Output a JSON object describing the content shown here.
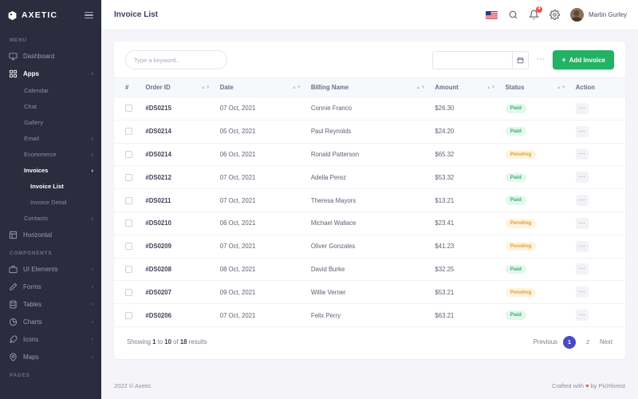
{
  "brand": {
    "name": "AXETIC",
    "logo_icon": "hexagon-shield-icon",
    "menu_icon": "hamburger-icon"
  },
  "sidebar": {
    "section_menu": "MENU",
    "section_components": "COMPONENTS",
    "section_pages": "PAGES",
    "items": [
      {
        "label": "Dashboard",
        "icon": "monitor-icon",
        "arrow": "",
        "active": false
      },
      {
        "label": "Apps",
        "icon": "grid-icon",
        "arrow": "›",
        "active": true
      }
    ],
    "apps_children": [
      {
        "label": "Calendar",
        "arrow": ""
      },
      {
        "label": "Chat",
        "arrow": ""
      },
      {
        "label": "Gallery",
        "arrow": ""
      },
      {
        "label": "Email",
        "arrow": "›"
      },
      {
        "label": "Ecommerce",
        "arrow": "›"
      },
      {
        "label": "Invoices",
        "arrow": "›"
      }
    ],
    "invoice_children": [
      {
        "label": "Invoice List",
        "active": true
      },
      {
        "label": "Invoice Detail",
        "active": false
      }
    ],
    "contacts": {
      "label": "Contacts",
      "arrow": "›"
    },
    "horizontal": {
      "label": "Horizontal",
      "icon": "layout-icon"
    },
    "components": [
      {
        "label": "UI Elements",
        "icon": "briefcase-icon",
        "arrow": "›"
      },
      {
        "label": "Forms",
        "icon": "pen-icon",
        "arrow": "›"
      },
      {
        "label": "Tables",
        "icon": "database-icon",
        "arrow": "›"
      },
      {
        "label": "Charts",
        "icon": "pie-chart-icon",
        "arrow": "›"
      },
      {
        "label": "Icons",
        "icon": "feather-icon",
        "arrow": "›"
      },
      {
        "label": "Maps",
        "icon": "map-pin-icon",
        "arrow": "›"
      }
    ]
  },
  "topbar": {
    "page_title": "Invoice List",
    "flag_icon": "us-flag-icon",
    "search_icon": "search-icon",
    "bell_icon": "bell-icon",
    "notification_count": "4",
    "gear_icon": "gear-icon",
    "user_name": "Martin Gurley",
    "avatar": "user-avatar"
  },
  "toolbar": {
    "search_placeholder": "Type a keyword...",
    "search_value": "",
    "date_value": "",
    "date_placeholder": "",
    "calendar_icon": "calendar-icon",
    "more_label": "⋯",
    "add_label": "Add Invoice",
    "add_plus": "+",
    "accent_green": "#22b264"
  },
  "table": {
    "columns": [
      {
        "label": "#",
        "sortable": false
      },
      {
        "label": "Order ID",
        "sortable": true
      },
      {
        "label": "Date",
        "sortable": true
      },
      {
        "label": "Billing Name",
        "sortable": true
      },
      {
        "label": "Amount",
        "sortable": true
      },
      {
        "label": "Status",
        "sortable": true
      },
      {
        "label": "Action",
        "sortable": false
      }
    ],
    "rows": [
      {
        "order_id": "#DS0215",
        "date": "07 Oct, 2021",
        "name": "Connie Franco",
        "amount": "$26.30",
        "status": "Paid",
        "status_type": "paid"
      },
      {
        "order_id": "#DS0214",
        "date": "05 Oct, 2021",
        "name": "Paul Reynolds",
        "amount": "$24.20",
        "status": "Paid",
        "status_type": "paid"
      },
      {
        "order_id": "#DS0214",
        "date": "06 Oct, 2021",
        "name": "Ronald Patterson",
        "amount": "$65.32",
        "status": "Pending",
        "status_type": "pending"
      },
      {
        "order_id": "#DS0212",
        "date": "07 Oct, 2021",
        "name": "Adella Perez",
        "amount": "$53.32",
        "status": "Paid",
        "status_type": "paid"
      },
      {
        "order_id": "#DS0211",
        "date": "07 Oct, 2021",
        "name": "Theresa Mayors",
        "amount": "$13.21",
        "status": "Paid",
        "status_type": "paid"
      },
      {
        "order_id": "#DS0210",
        "date": "06 Oct, 2021",
        "name": "Michael Wallace",
        "amount": "$23.41",
        "status": "Pending",
        "status_type": "pending"
      },
      {
        "order_id": "#DS0209",
        "date": "07 Oct, 2021",
        "name": "Oliver Gonzales",
        "amount": "$41.23",
        "status": "Pending",
        "status_type": "pending"
      },
      {
        "order_id": "#DS0208",
        "date": "08 Oct, 2021",
        "name": "David Burke",
        "amount": "$32.25",
        "status": "Paid",
        "status_type": "paid"
      },
      {
        "order_id": "#DS0207",
        "date": "09 Oct, 2021",
        "name": "Willie Verner",
        "amount": "$53.21",
        "status": "Pending",
        "status_type": "pending"
      },
      {
        "order_id": "#DS0206",
        "date": "07 Oct, 2021",
        "name": "Felix Perry",
        "amount": "$63.21",
        "status": "Paid",
        "status_type": "paid"
      }
    ],
    "action_label": "⋯"
  },
  "pagination": {
    "showing_prefix": "Showing",
    "from": "1",
    "mid": "to",
    "to": "10",
    "of": "of",
    "total": "18",
    "suffix": "results",
    "previous": "Previous",
    "next": "Next",
    "pages": [
      {
        "label": "1",
        "active": true
      },
      {
        "label": "2",
        "active": false
      }
    ],
    "active_color": "#4a4ac4"
  },
  "footer": {
    "copyright": "2022 © Axetic.",
    "crafted_prefix": "Crafted with",
    "heart": "♥",
    "crafted_suffix": "by Pichforest"
  }
}
